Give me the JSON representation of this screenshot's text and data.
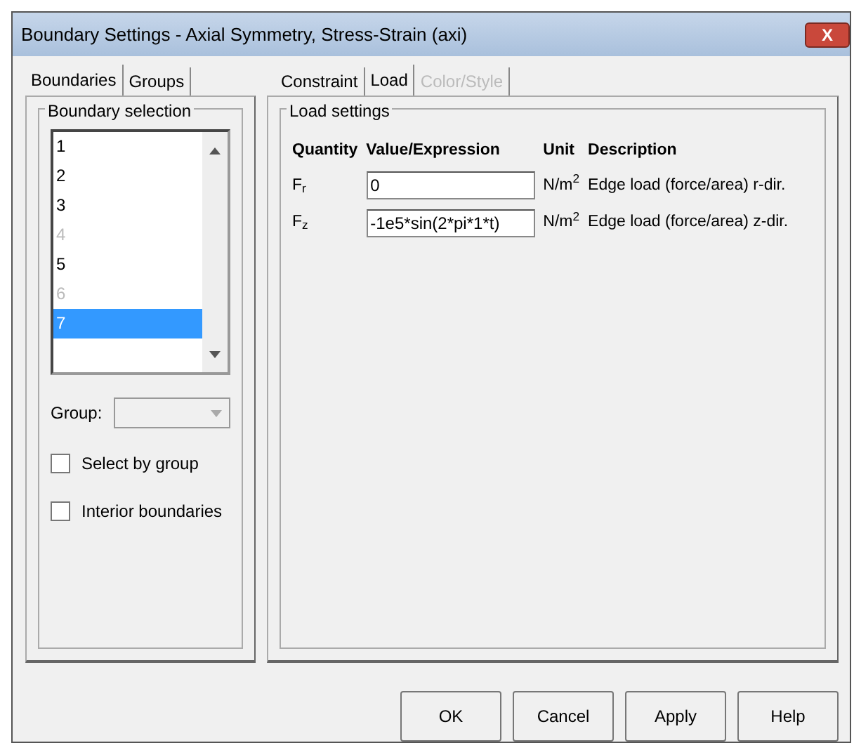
{
  "window": {
    "title": "Boundary Settings - Axial Symmetry, Stress-Strain (axi)",
    "close": "X"
  },
  "left_tabs": [
    {
      "label": "Boundaries",
      "selected": true
    },
    {
      "label": "Groups",
      "selected": false
    }
  ],
  "boundary_selection": {
    "title": "Boundary selection",
    "items": [
      {
        "label": "1",
        "disabled": false,
        "selected": false
      },
      {
        "label": "2",
        "disabled": false,
        "selected": false
      },
      {
        "label": "3",
        "disabled": false,
        "selected": false
      },
      {
        "label": "4",
        "disabled": true,
        "selected": false
      },
      {
        "label": "5",
        "disabled": false,
        "selected": false
      },
      {
        "label": "6",
        "disabled": true,
        "selected": false
      },
      {
        "label": "7",
        "disabled": false,
        "selected": true
      }
    ],
    "group_label": "Group:",
    "group_disabled": true,
    "checkboxes": [
      {
        "label": "Select by group",
        "checked": false
      },
      {
        "label": "Interior boundaries",
        "checked": false
      }
    ]
  },
  "right_tabs": [
    {
      "label": "Constraint",
      "selected": false,
      "disabled": false
    },
    {
      "label": "Load",
      "selected": true,
      "disabled": false
    },
    {
      "label": "Color/Style",
      "selected": false,
      "disabled": true
    }
  ],
  "load_settings": {
    "title": "Load settings",
    "columns": [
      "Quantity",
      "Value/Expression",
      "Unit",
      "Description"
    ],
    "rows": [
      {
        "quantity": "F$_{r}$",
        "value": "0",
        "unit": "N/m$^{2}$",
        "description": "Edge load (force/area) r-dir."
      },
      {
        "quantity": "F$_{z}$",
        "value": "-1e5*sin(2*pi*1*t)",
        "unit": "N/m$^{2}$",
        "description": "Edge load (force/area) z-dir."
      }
    ]
  },
  "buttons": [
    "OK",
    "Cancel",
    "Apply",
    "Help"
  ]
}
